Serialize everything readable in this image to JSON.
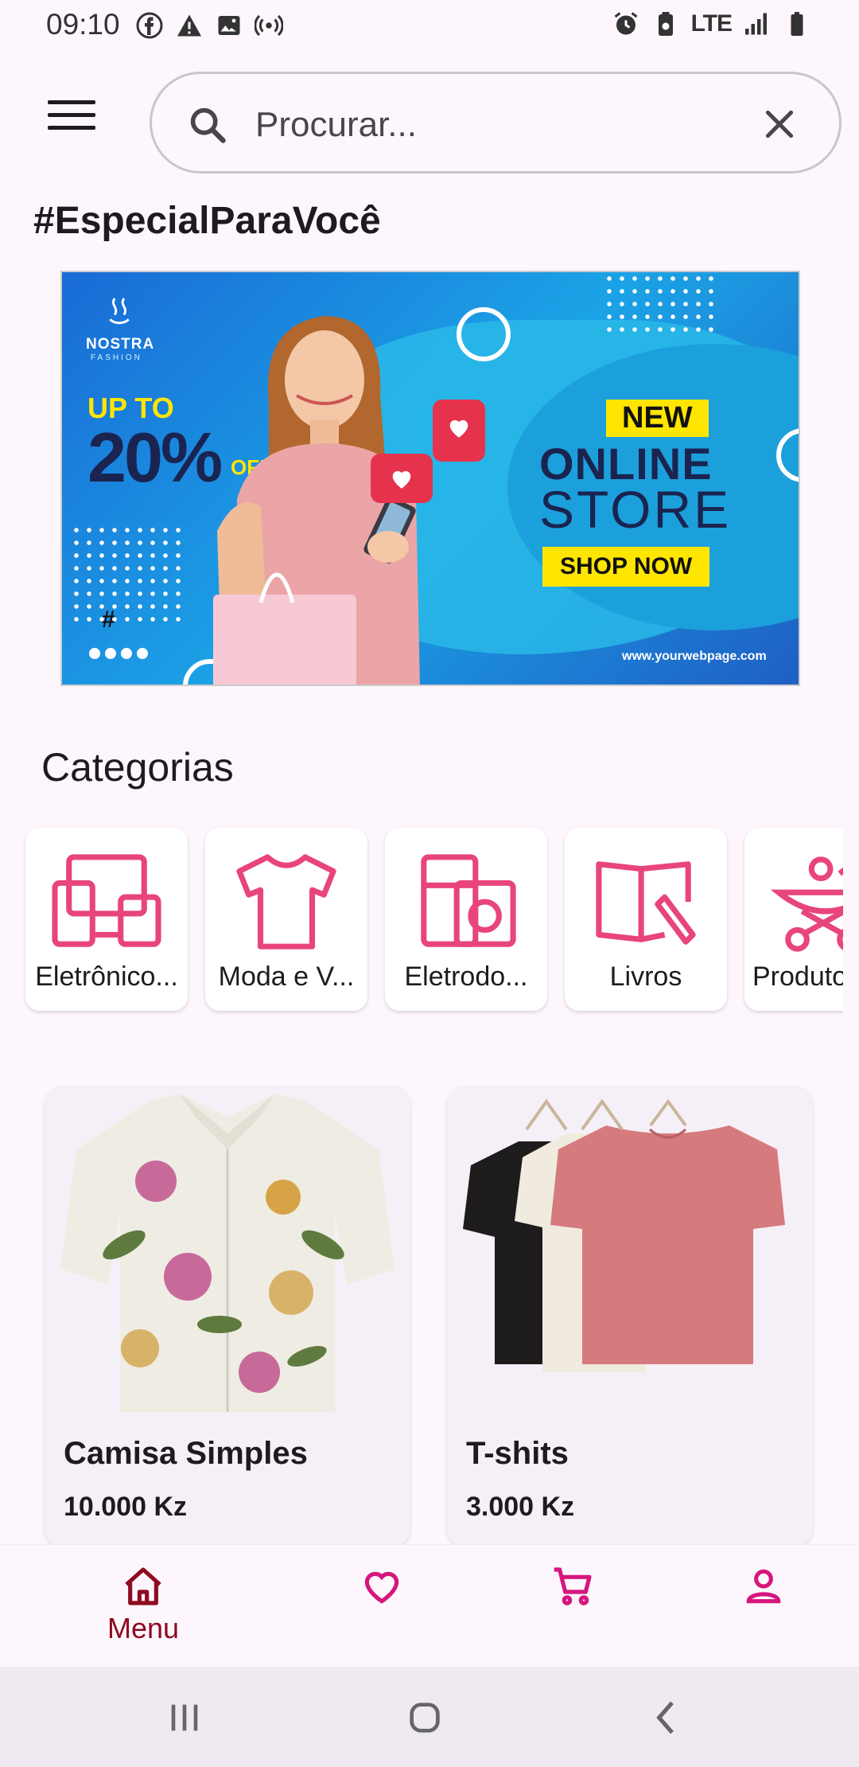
{
  "status_bar": {
    "time": "09:10",
    "network": "LTE"
  },
  "search": {
    "placeholder": "Procurar..."
  },
  "special_title": "#EspecialParaVocê",
  "banner": {
    "brand": "NOSTRA",
    "brand_sub": "FASHION",
    "upto": "UP TO",
    "percent": "20%",
    "off": "OFF",
    "new": "NEW",
    "online": "ONLINE",
    "store": "STORE",
    "shop_now": "SHOP NOW",
    "url": "www.yourwebpage.com",
    "hashtag": "#"
  },
  "categories_title": "Categorias",
  "categories": [
    {
      "label": "Eletrônico...",
      "icon": "devices-icon"
    },
    {
      "label": "Moda e V...",
      "icon": "tshirt-icon"
    },
    {
      "label": "Eletrodo...",
      "icon": "appliances-icon"
    },
    {
      "label": "Livros",
      "icon": "book-icon"
    },
    {
      "label": "Produto",
      "icon": "stroller-icon"
    }
  ],
  "products": [
    {
      "name": "Camisa Simples",
      "price": "10.000 Kz"
    },
    {
      "name": "T-shits",
      "price": "3.000 Kz"
    }
  ],
  "bottom_nav": {
    "menu_label": "Menu",
    "items": [
      "home-icon",
      "heart-icon",
      "cart-icon",
      "person-icon"
    ]
  },
  "colors": {
    "accent_pink": "#e8457a",
    "nav_active": "#8e0b21",
    "nav_icon": "#d6167e"
  }
}
